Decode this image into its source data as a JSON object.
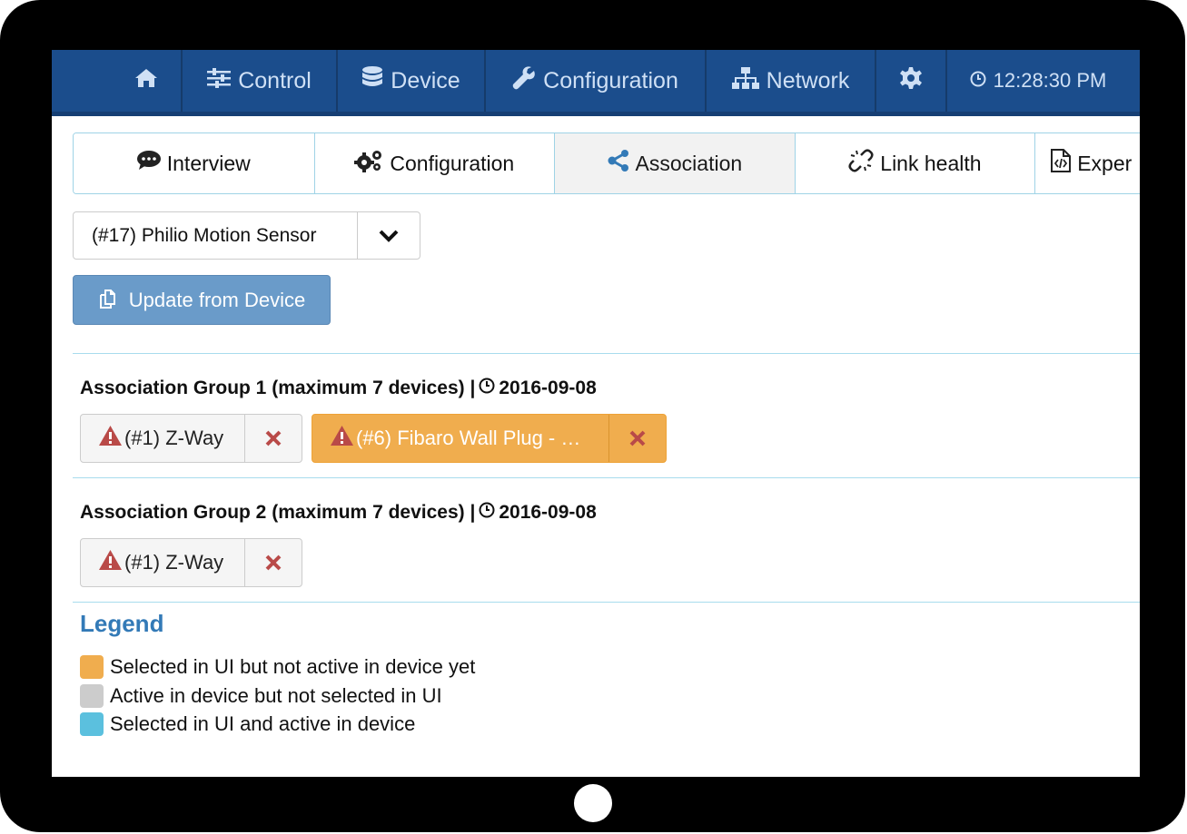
{
  "nav": {
    "home_icon": "home-icon",
    "control": "Control",
    "device": "Device",
    "configuration": "Configuration",
    "network": "Network",
    "settings_icon": "gear-icon",
    "clock": "12:28:30 PM"
  },
  "tabs": [
    {
      "label": "Interview",
      "icon": "comment-icon"
    },
    {
      "label": "Configuration",
      "icon": "gears-icon"
    },
    {
      "label": "Association",
      "icon": "share-icon",
      "active": true
    },
    {
      "label": "Link health",
      "icon": "broken-link-icon"
    },
    {
      "label": "Exper",
      "icon": "code-file-icon"
    }
  ],
  "device_select": {
    "value": "(#17) Philio Motion Sensor"
  },
  "update_button": {
    "label": "Update from Device"
  },
  "groups": [
    {
      "title": "Association Group 1 (maximum 7 devices) |",
      "date": "2016-09-08",
      "devices": [
        {
          "label": "(#1) Z-Way",
          "state": "active-not-selected"
        },
        {
          "label": "(#6) Fibaro Wall Plug - …",
          "state": "selected-not-active"
        }
      ]
    },
    {
      "title": "Association Group 2 (maximum 7 devices) |",
      "date": "2016-09-08",
      "devices": [
        {
          "label": "(#1) Z-Way",
          "state": "active-not-selected"
        }
      ]
    }
  ],
  "legend": {
    "title": "Legend",
    "items": [
      {
        "label": "Selected in UI but not active in device yet",
        "color": "#f0ad4e"
      },
      {
        "label": "Active in device but not selected in UI",
        "color": "#cccccc"
      },
      {
        "label": "Selected in UI and active in device",
        "color": "#5bc0de"
      }
    ]
  },
  "colors": {
    "navbar": "#1b4d8c",
    "primary_button": "#6a9bc9",
    "warning": "#f0ad4e",
    "danger": "#b94a48",
    "link": "#337ab7"
  }
}
